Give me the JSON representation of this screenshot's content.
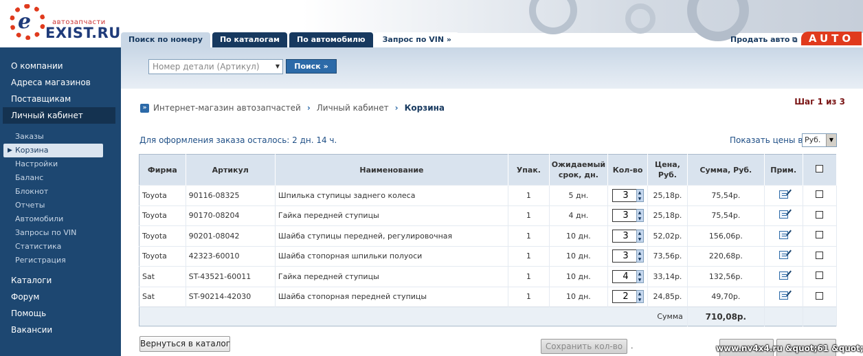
{
  "logo": {
    "small": "автозапчасти",
    "big": "EXIST.RU",
    "letter": "e"
  },
  "tabs": [
    {
      "label": "Поиск по номеру"
    },
    {
      "label": "По каталогам"
    },
    {
      "label": "По автомобилю"
    },
    {
      "label": "Запрос по VIN »"
    }
  ],
  "sell_label": "Продать авто",
  "auto_badge": "AUTO",
  "sidebar": {
    "main_items": [
      {
        "label": "О компании"
      },
      {
        "label": "Адреса магазинов"
      },
      {
        "label": "Поставщикам"
      },
      {
        "label": "Личный кабинет"
      }
    ],
    "sub_items": [
      {
        "label": "Заказы"
      },
      {
        "label": "Корзина"
      },
      {
        "label": "Настройки"
      },
      {
        "label": "Баланс"
      },
      {
        "label": "Блокнот"
      },
      {
        "label": "Отчеты"
      },
      {
        "label": "Автомобили"
      },
      {
        "label": "Запросы по VIN"
      },
      {
        "label": "Статистика"
      },
      {
        "label": "Регистрация"
      }
    ],
    "bottom_items": [
      {
        "label": "Каталоги"
      },
      {
        "label": "Форум"
      },
      {
        "label": "Помощь"
      },
      {
        "label": "Вакансии"
      }
    ]
  },
  "search": {
    "placeholder": "Номер детали (Артикул)",
    "button": "Поиск »"
  },
  "breadcrumb": {
    "home": "Интернет-магазин автозапчастей",
    "middle": "Личный кабинет",
    "current": "Корзина"
  },
  "step": "Шаг 1 из 3",
  "remaining": "Для оформления заказа осталось: 2 дн. 14 ч.",
  "price_in_label": "Показать цены в:",
  "currency": "Руб.",
  "table": {
    "headers": {
      "firm": "Фирма",
      "article": "Артикул",
      "name": "Наименование",
      "pack": "Упак.",
      "term_1": "Ожидаемый",
      "term_2": "срок, дн.",
      "qty": "Кол-во",
      "price_1": "Цена,",
      "price_2": "Руб.",
      "sum": "Сумма, Руб.",
      "note": "Прим."
    },
    "rows": [
      {
        "firm": "Toyota",
        "article": "90116-08325",
        "name": "Шпилька ступицы заднего колеса",
        "pack": "1",
        "term": "5 дн.",
        "qty": "3",
        "price": "25,18р.",
        "sum": "75,54р."
      },
      {
        "firm": "Toyota",
        "article": "90170-08204",
        "name": "Гайка передней ступицы",
        "pack": "1",
        "term": "4 дн.",
        "qty": "3",
        "price": "25,18р.",
        "sum": "75,54р."
      },
      {
        "firm": "Toyota",
        "article": "90201-08042",
        "name": "Шайба ступицы передней, регулировочная",
        "pack": "1",
        "term": "10 дн.",
        "qty": "3",
        "price": "52,02р.",
        "sum": "156,06р."
      },
      {
        "firm": "Toyota",
        "article": "42323-60010",
        "name": "Шайба стопорная шпильки полуоси",
        "pack": "1",
        "term": "10 дн.",
        "qty": "3",
        "price": "73,56р.",
        "sum": "220,68р."
      },
      {
        "firm": "Sat",
        "article": "ST-43521-60011",
        "name": "Гайка передней ступицы",
        "pack": "1",
        "term": "10 дн.",
        "qty": "4",
        "price": "33,14р.",
        "sum": "132,56р."
      },
      {
        "firm": "Sat",
        "article": "ST-90214-42030",
        "name": "Шайба стопорная передней ступицы",
        "pack": "1",
        "term": "10 дн.",
        "qty": "2",
        "price": "24,85р.",
        "sum": "49,70р."
      }
    ],
    "total_label": "Сумма",
    "total_value": "710,08р."
  },
  "buttons": {
    "back": "Вернуться в каталог",
    "save_qty": "Сохранить кол-во",
    "dot": "."
  },
  "watermark": "www.nv4x4.ru &quot;61 &quot;"
}
